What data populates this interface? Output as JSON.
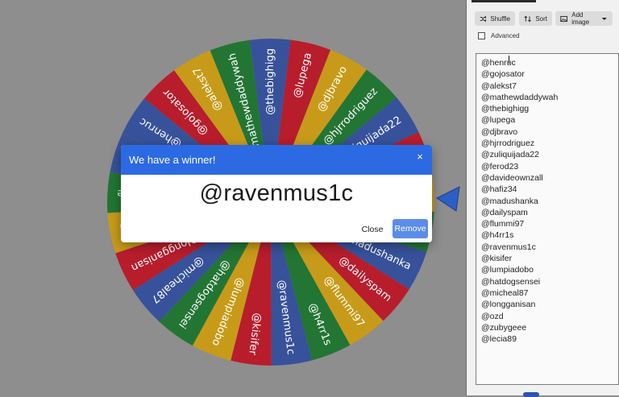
{
  "wheel": {
    "rotation_deg": -155,
    "colors": [
      "#37529a",
      "#b81d2c",
      "#c79b19",
      "#237534"
    ],
    "entries": [
      "@henruc",
      "@gojosator",
      "@alekst7",
      "@mathewdaddywah",
      "@thebighigg",
      "@lupega",
      "@djbravo",
      "@hjrrodriguez",
      "@zuliquijada22",
      "@ferod23",
      "@davideownzall",
      "@hafiz34",
      "@madushanka",
      "@dailyspam",
      "@flummi97",
      "@h4rr1s",
      "@ravenmus1c",
      "@kisifer",
      "@lumpiadobo",
      "@hatdogsensei",
      "@micheal87",
      "@longganisan",
      "@ozd",
      "@zubygeee",
      "@lecia89"
    ],
    "pointer_color": "#2c5fc6"
  },
  "toolbar": {
    "shuffle_label": "Shuffle",
    "sort_label": "Sort",
    "add_image_label": "Add image"
  },
  "advanced": {
    "label": "Advanced",
    "checked": false
  },
  "entries_text": [
    "@henruc",
    "@gojosator",
    "@alekst7",
    "@mathewdaddywah",
    "@thebighigg",
    "@lupega",
    "@djbravo",
    "@hjrrodriguez",
    "@zuliquijada22",
    "@ferod23",
    "@davideownzall",
    "@hafiz34",
    "@madushanka",
    "@dailyspam",
    "@flummi97",
    "@h4rr1s",
    "@ravenmus1c",
    "@kisifer",
    "@lumpiadobo",
    "@hatdogsensei",
    "@micheal87",
    "@longganisan",
    "@ozd",
    "@zubygeee",
    "@lecia89"
  ],
  "dialog": {
    "title": "We have a winner!",
    "winner": "@ravenmus1c",
    "close_label": "Close",
    "remove_label": "Remove",
    "close_icon": "×",
    "header_color": "#2c6ae4"
  }
}
